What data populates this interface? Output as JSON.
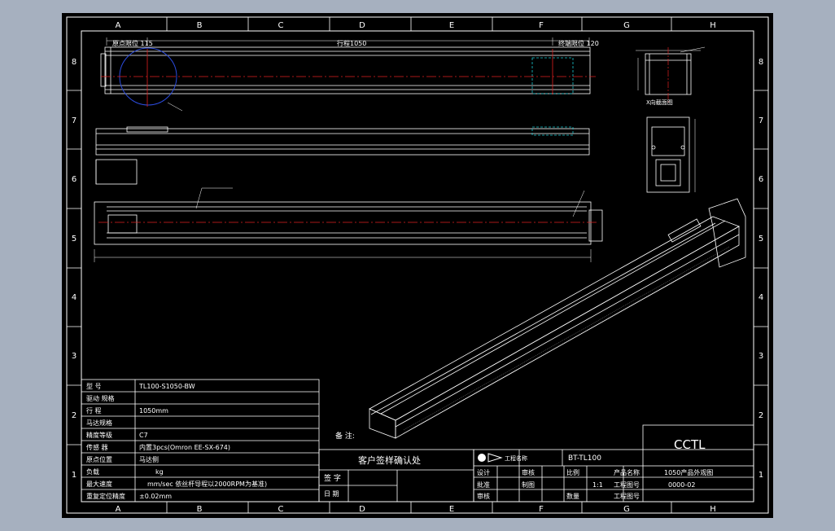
{
  "zones": {
    "columns": [
      "A",
      "B",
      "C",
      "D",
      "E",
      "F",
      "G",
      "H"
    ],
    "rows": [
      "8",
      "7",
      "6",
      "5",
      "4",
      "3",
      "2",
      "1"
    ]
  },
  "dims": {
    "top_left": "原点限位 115",
    "stroke": "行程1050",
    "top_right": "终端限位 120"
  },
  "section_label": "X向截面图",
  "spec_table": [
    {
      "label": "型  号",
      "value": "TL100-S1050-BW"
    },
    {
      "label": "驱动 规格",
      "value": ""
    },
    {
      "label": "行  程",
      "value": "1050mm"
    },
    {
      "label": "马达规格",
      "value": ""
    },
    {
      "label": "精度等级",
      "value": "C7"
    },
    {
      "label": "传感 器",
      "value": "内置3pcs(Omron EE-SX-674)"
    },
    {
      "label": "原点位置",
      "value": "马达侧"
    },
    {
      "label": "负载",
      "value": "kg"
    },
    {
      "label": "最大速度",
      "value": "mm/sec 依丝杆导程以2000RPM为基准)"
    },
    {
      "label": "重复定位精度",
      "value": "±0.02mm"
    }
  ],
  "notes_label": "备  注:",
  "confirm_title": "客户签样确认处",
  "sign_label": "签  字",
  "date_label": "日  期",
  "title_block": {
    "brand": "CCTL",
    "project_label": "工程名称",
    "project_value": "BT-TL100",
    "design": "设计",
    "check": "审核",
    "approve": "批准",
    "drawing": "制图",
    "review": "审核",
    "scale": "比例",
    "scale_value": "1:1",
    "quantity": "数量",
    "product_name_label": "产品名称",
    "product_name_value": "1050产品外观图",
    "drawing_no_label": "工程图号",
    "drawing_no_value": "0000-02",
    "sheet_label": "工程图号"
  }
}
